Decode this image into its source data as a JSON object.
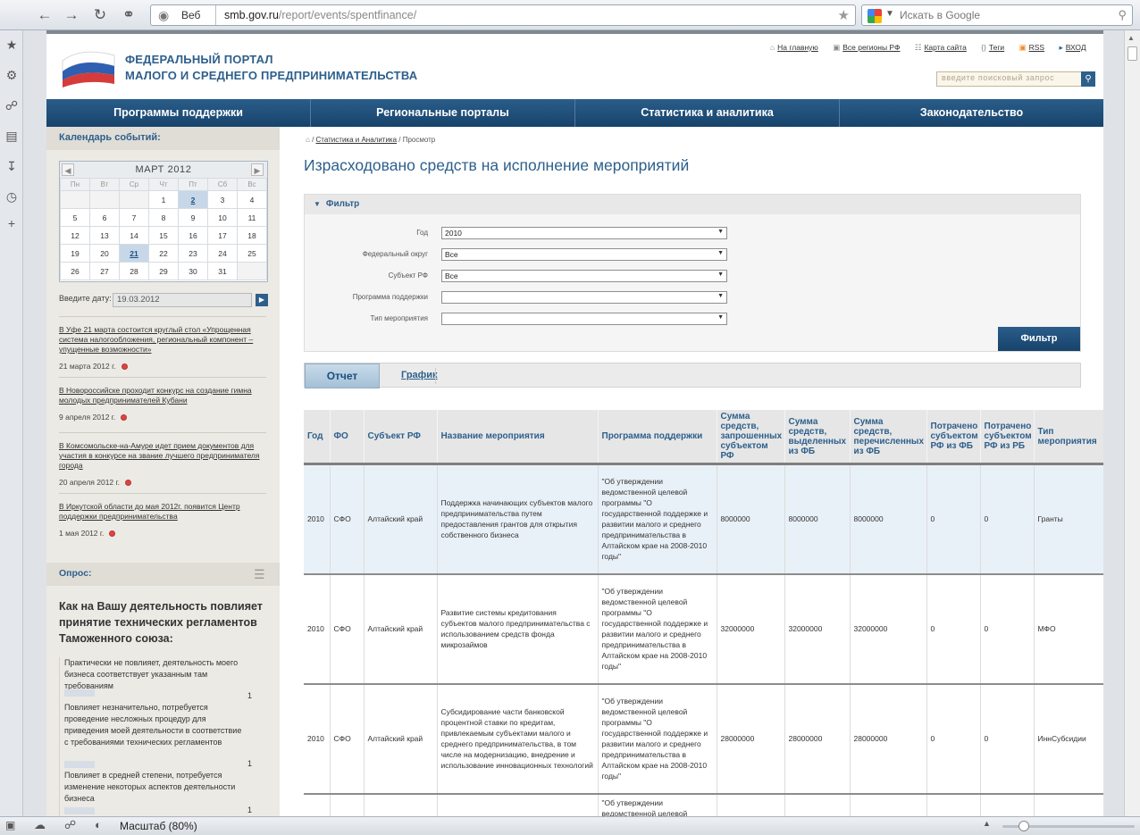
{
  "browser": {
    "address_mode": "Веб",
    "url_host": "smb.gov.ru",
    "url_path": "/report/events/spentfinance/",
    "search_placeholder": "Искать в Google",
    "zoom_label": "Масштаб (80%)"
  },
  "site": {
    "logo_line1": "ФЕДЕРАЛЬНЫЙ ПОРТАЛ",
    "logo_line2": "МАЛОГО И СРЕДНЕГО ПРЕДПРИНИМАТЕЛЬСТВА",
    "top_links": [
      "На главную",
      "Все регионы РФ",
      "Карта сайта",
      "Теги",
      "RSS",
      "ВХОД"
    ],
    "search_placeholder": "введите поисковый запрос",
    "nav": [
      "Программы поддержки",
      "Региональные порталы",
      "Статистика и аналитика",
      "Законодательство"
    ]
  },
  "sidebar": {
    "calendar_title": "Календарь событий:",
    "month": "МАРТ 2012",
    "weekdays": [
      "Пн",
      "Вт",
      "Ср",
      "Чт",
      "Пт",
      "Сб",
      "Вс"
    ],
    "weeks": [
      [
        "",
        "",
        "",
        "1",
        "2",
        "3",
        "4"
      ],
      [
        "5",
        "6",
        "7",
        "8",
        "9",
        "10",
        "11"
      ],
      [
        "12",
        "13",
        "14",
        "15",
        "16",
        "17",
        "18"
      ],
      [
        "19",
        "20",
        "21",
        "22",
        "23",
        "24",
        "25"
      ],
      [
        "26",
        "27",
        "28",
        "29",
        "30",
        "31",
        ""
      ]
    ],
    "date_label": "Введите дату:",
    "date_value": "19.03.2012",
    "news": [
      {
        "title": "В Уфе 21 марта состоится круглый стол «Упрощенная система налогообложения, региональный компонент – упущенные возможности»",
        "date": "21 марта 2012 г."
      },
      {
        "title": "В Новороссийске проходит конкурс на создание гимна молодых предпринимателей Кубани",
        "date": "9 апреля 2012 г."
      },
      {
        "title": "В Комсомольске-на-Амуре идет прием документов для участия в конкурсе на звание лучшего предпринимателя города",
        "date": "20 апреля 2012 г."
      },
      {
        "title": "В Иркутской области до мая 2012г. появится Центр поддержки предпринимательства",
        "date": "1 мая 2012 г."
      }
    ],
    "poll_title": "Опрос:",
    "poll_question": "Как на Вашу деятельность повлияет принятие технических регламентов Таможенного союза:",
    "poll_options": [
      {
        "text": "Практически не повлияет, деятельность моего бизнеса соответствует указанным там требованиям",
        "count": "1"
      },
      {
        "text": "Повлияет незначительно, потребуется проведение несложных процедур для приведения моей деятельности в соответствие с требованиями технических регламентов",
        "count": "1"
      },
      {
        "text": "Повлияет в средней степени, потребуется изменение некоторых аспектов деятельности бизнеса",
        "count": "1"
      }
    ]
  },
  "main": {
    "breadcrumb": {
      "link": "Статистика и Аналитика",
      "current": "Просмотр"
    },
    "title": "Израсходовано средств на исполнение мероприятий",
    "filter": {
      "title": "Фильтр",
      "fields": [
        {
          "label": "Год",
          "value": "2010"
        },
        {
          "label": "Федеральный округ",
          "value": "Все"
        },
        {
          "label": "Субъект РФ",
          "value": "Все"
        },
        {
          "label": "Программа поддержки",
          "value": ""
        },
        {
          "label": "Тип мероприятия",
          "value": ""
        }
      ],
      "button": "Фильтр"
    },
    "tabs": [
      "Отчет",
      "График"
    ],
    "table": {
      "headers": [
        "Год",
        "ФО",
        "Субъект РФ",
        "Название мероприятия",
        "Программа поддержки",
        "Сумма средств, запрошенных субъектом РФ",
        "Сумма средств, выделенных из ФБ",
        "Сумма средств, перечисленных из ФБ",
        "Потрачено субъектом РФ из ФБ",
        "Потрачено субъектом РФ из РБ",
        "Тип мероприятия"
      ],
      "rows": [
        [
          "2010",
          "СФО",
          "Алтайский край",
          "Поддержка начинающих субъектов малого предпринимательства путем предоставления грантов для открытия собственного бизнеса",
          "\"Об утверждении ведомственной целевой программы \"О государственной поддержке и развитии малого и среднего предпринимательства в Алтайском крае на 2008-2010 годы\"",
          "8000000",
          "8000000",
          "8000000",
          "0",
          "0",
          "Гранты"
        ],
        [
          "2010",
          "СФО",
          "Алтайский край",
          "Развитие системы кредитования субъектов малого предпринимательства с использованием средств фонда микрозаймов",
          "\"Об утверждении ведомственной целевой программы \"О государственной поддержке и развитии малого и среднего предпринимательства в Алтайском крае на 2008-2010 годы\"",
          "32000000",
          "32000000",
          "32000000",
          "0",
          "0",
          "МФО"
        ],
        [
          "2010",
          "СФО",
          "Алтайский край",
          "Субсидирование части банковской процентной ставки по кредитам, привлекаемым субъектами малого и среднего предпринимательства, в том числе на модернизацию, внедрение и использование инновационных технологий",
          "\"Об утверждении ведомственной целевой программы \"О государственной поддержке и развитии малого и среднего предпринимательства в Алтайском крае на 2008-2010 годы\"",
          "28000000",
          "28000000",
          "28000000",
          "0",
          "0",
          "ИннСубсидии"
        ],
        [
          "",
          "",
          "",
          "",
          "\"Об утверждении ведомственной целевой",
          "",
          "",
          "",
          "",
          "",
          ""
        ]
      ]
    }
  }
}
